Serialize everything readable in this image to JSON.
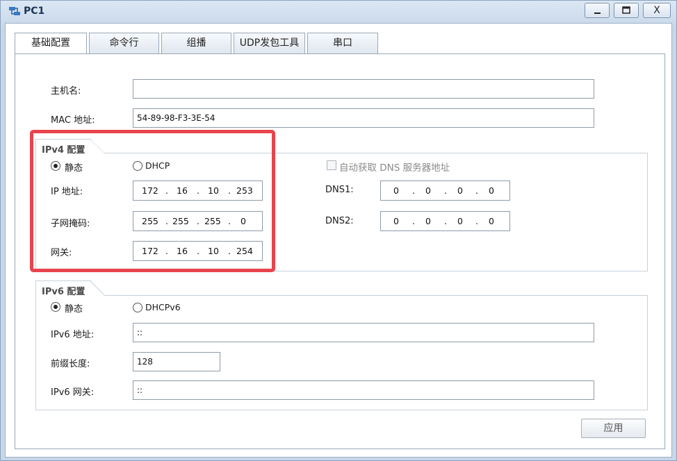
{
  "window": {
    "title": "PC1",
    "minimize": "_",
    "maximize": "□",
    "close": "X"
  },
  "tabs": [
    "基础配置",
    "命令行",
    "组播",
    "UDP发包工具",
    "串口"
  ],
  "basic": {
    "hostname_label": "主机名:",
    "hostname_value": "",
    "mac_label": "MAC 地址:",
    "mac_value": "54-89-98-F3-3E-54"
  },
  "ipv4": {
    "title": "IPv4 配置",
    "static_label": "静态",
    "dhcp_label": "DHCP",
    "mode": "static",
    "ip_label": "IP 地址:",
    "ip": [
      "172",
      "16",
      "10",
      "253"
    ],
    "mask_label": "子网掩码:",
    "mask": [
      "255",
      "255",
      "255",
      "0"
    ],
    "gateway_label": "网关:",
    "gateway": [
      "172",
      "16",
      "10",
      "254"
    ],
    "auto_dns_label": "自动获取 DNS 服务器地址",
    "auto_dns_checked": false,
    "dns1_label": "DNS1:",
    "dns1": [
      "0",
      "0",
      "0",
      "0"
    ],
    "dns2_label": "DNS2:",
    "dns2": [
      "0",
      "0",
      "0",
      "0"
    ]
  },
  "ipv6": {
    "title": "IPv6 配置",
    "static_label": "静态",
    "dhcp_label": "DHCPv6",
    "mode": "static",
    "addr_label": "IPv6 地址:",
    "addr_value": "::",
    "prefix_label": "前缀长度:",
    "prefix_value": "128",
    "gateway_label": "IPv6 网关:",
    "gateway_value": "::"
  },
  "apply_label": "应用",
  "colors": {
    "highlight": "#e8444c",
    "titlebar": "#c8d7e8",
    "accent_text": "#1b3557"
  }
}
